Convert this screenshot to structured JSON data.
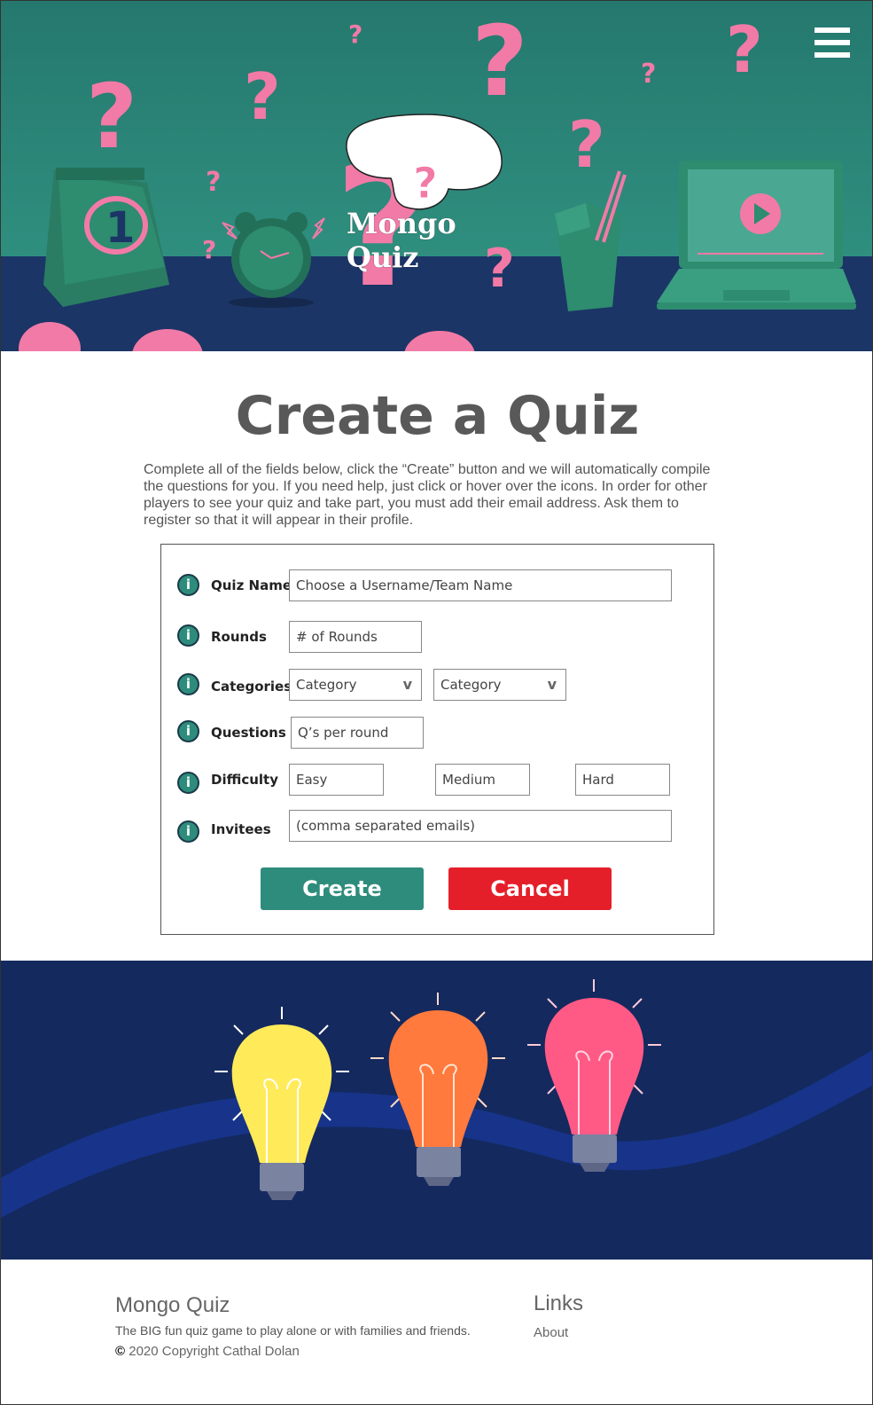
{
  "hero": {
    "brand": "Mongo Quiz",
    "menu_icon": "hamburger-menu-icon",
    "colors": {
      "sky_top": "#24786e",
      "sky_bottom": "#2c8a7b",
      "floor": "#1b3566",
      "accent_pink": "#f27aa6",
      "object_green": "#2e8c6f"
    }
  },
  "main": {
    "title": "Create a Quiz",
    "intro": "Complete all of the fields below, click the “Create” button and we will automatically compile the questions for you. If you need help, just click or hover over the icons. In order for other players to see your quiz and take part, you must add  their email address. Ask them to register so that it will appear in their profile."
  },
  "form": {
    "quiz_name": {
      "label": "Quiz Name",
      "placeholder": "Choose a Username/Team Name"
    },
    "rounds": {
      "label": "Rounds",
      "placeholder": "# of Rounds"
    },
    "categories": {
      "label": "Categories",
      "select_1": "Category",
      "select_2": "Category",
      "chevron": "v"
    },
    "questions": {
      "label": "Questions",
      "placeholder": "Q’s per round"
    },
    "difficulty": {
      "label": "Difficulty",
      "easy": "Easy",
      "medium": "Medium",
      "hard": "Hard"
    },
    "invitees": {
      "label": "Invitees",
      "placeholder": "(comma separated emails)"
    },
    "info_glyph": "i",
    "create_label": "Create",
    "cancel_label": "Cancel",
    "colors": {
      "create": "#2e8c7c",
      "cancel": "#e51f2a"
    }
  },
  "bulbs": {
    "colors": {
      "background": "#14295e",
      "wave": "#17348a",
      "yellow": "#ffea5a",
      "orange": "#ff7a3c",
      "pink": "#ff5a86",
      "base": "#7a83a0"
    }
  },
  "footer": {
    "brand": "Mongo Quiz",
    "tagline": "The BIG fun quiz game to play alone or with families and friends.",
    "copyright_symbol": "©",
    "copyright": "2020 Copyright Cathal Dolan",
    "links_title": "Links",
    "about": "About"
  }
}
